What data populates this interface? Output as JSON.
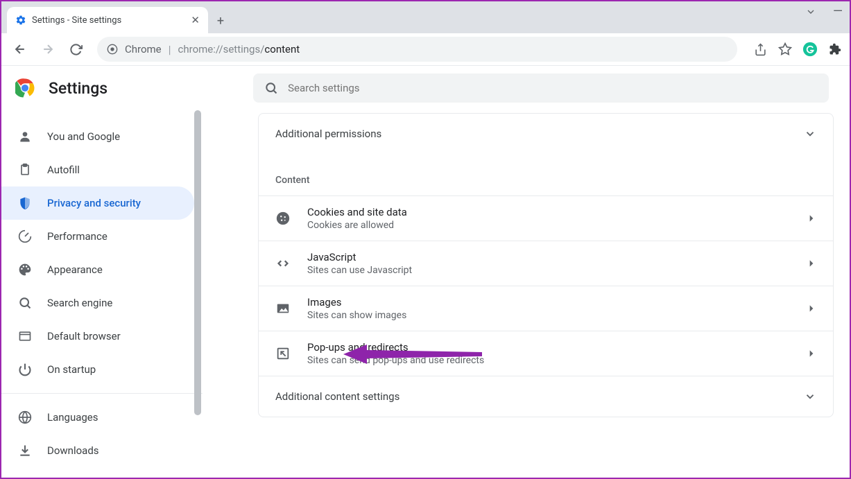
{
  "tab": {
    "title": "Settings - Site settings"
  },
  "omnibox": {
    "prefix": "Chrome",
    "url_dim": "chrome://settings/",
    "url_path": "content"
  },
  "header": {
    "title": "Settings",
    "search_placeholder": "Search settings"
  },
  "sidebar": {
    "items": [
      {
        "label": "You and Google"
      },
      {
        "label": "Autofill"
      },
      {
        "label": "Privacy and security"
      },
      {
        "label": "Performance"
      },
      {
        "label": "Appearance"
      },
      {
        "label": "Search engine"
      },
      {
        "label": "Default browser"
      },
      {
        "label": "On startup"
      }
    ],
    "items2": [
      {
        "label": "Languages"
      },
      {
        "label": "Downloads"
      }
    ]
  },
  "main": {
    "additional_permissions": "Additional permissions",
    "content_label": "Content",
    "rows": [
      {
        "title": "Cookies and site data",
        "sub": "Cookies are allowed"
      },
      {
        "title": "JavaScript",
        "sub": "Sites can use Javascript"
      },
      {
        "title": "Images",
        "sub": "Sites can show images"
      },
      {
        "title": "Pop-ups and redirects",
        "sub": "Sites can send pop-ups and use redirects"
      }
    ],
    "additional_content": "Additional content settings"
  }
}
